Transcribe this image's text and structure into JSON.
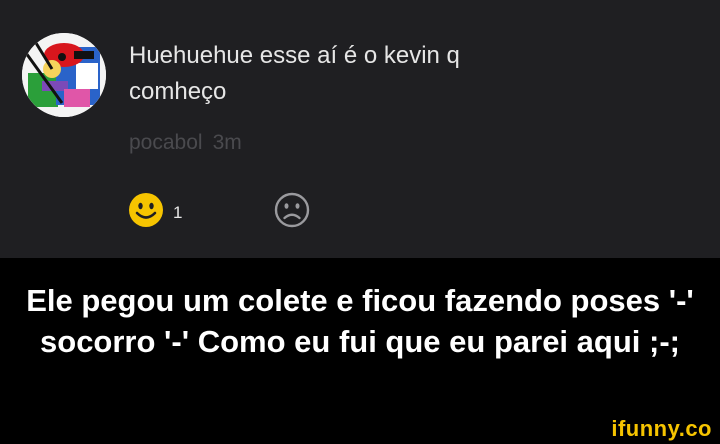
{
  "comment": {
    "text": "Huehuehue esse aí é o kevin q\ncomheço",
    "username": "pocabol",
    "time": "3m",
    "reactions": {
      "happy": {
        "icon": "smiley-face-icon",
        "count": "1",
        "color": "#f6c400"
      },
      "sad": {
        "icon": "sad-face-icon",
        "color": "#9a9a9e"
      }
    }
  },
  "caption": {
    "text": "Ele pegou um colete e ficou fazendo poses '-' socorro '-' Como eu fui que eu parei aqui ;-;"
  },
  "watermark": {
    "text": "ifunny.co",
    "color": "#f6c400"
  },
  "colors": {
    "panel_background": "#1f1f22",
    "caption_background": "#000000",
    "meta_text": "#4a4a4e"
  }
}
